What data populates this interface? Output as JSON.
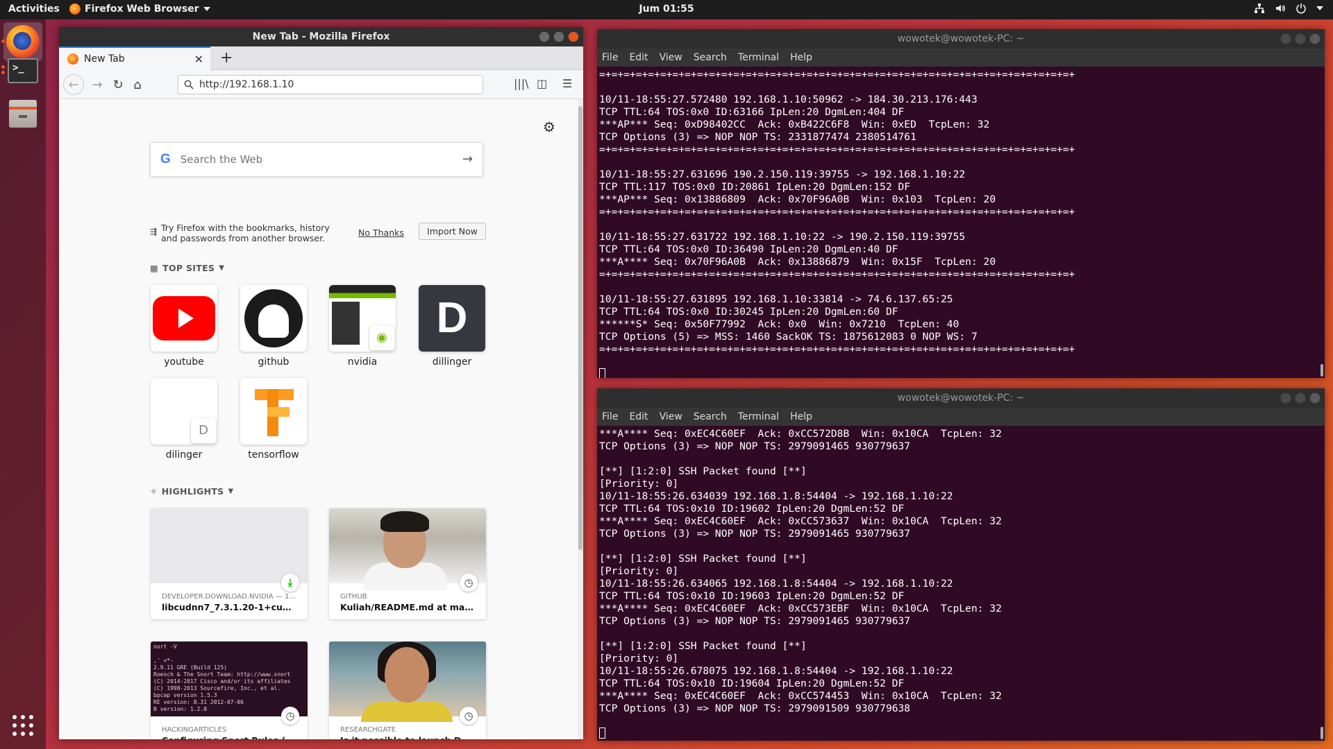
{
  "topbar": {
    "activities": "Activities",
    "app_name": "Firefox Web Browser",
    "clock": "Jum 01:55"
  },
  "firefox": {
    "window_title": "New Tab - Mozilla Firefox",
    "tab_title": "New Tab",
    "url": "http://192.168.1.10",
    "search_placeholder": "Search the Web",
    "google_letter": "G",
    "import_text": "Try Firefox with the bookmarks, history and passwords from another browser.",
    "no_thanks": "No Thanks",
    "import_now": "Import Now",
    "top_sites_title": "TOP SITES",
    "top_sites": [
      {
        "label": "youtube"
      },
      {
        "label": "github"
      },
      {
        "label": "nvidia"
      },
      {
        "label": "dillinger",
        "letter": "D"
      },
      {
        "label": "dilinger",
        "letter": "D"
      },
      {
        "label": "tensorflow"
      }
    ],
    "highlights_title": "HIGHLIGHTS",
    "highlights": [
      {
        "source": "DEVELOPER.DOWNLOAD.NVIDIA — 12...",
        "title": "libcudnn7_7.3.1.20-1+cuda9.0_a..."
      },
      {
        "source": "GITHUB",
        "title": "Kuliah/README.md at master · ..."
      },
      {
        "source": "HACKINGARTICLES",
        "title": "Configuring Snort Rules (Basic...",
        "screenshot_text": "nort -V\n\n,' <*-\n2.9.11 GRE (Build 125)\nRoesch & The Snort Team: http://www.snort\n(C) 2014-2017 Cisco and/or its affiliates\n(C) 1998-2013 Sourcefire, Inc., et al.\nbpcap version 1.5.3\nRE version: 8.31 2012-07-06\nB version: 1.2.8"
      },
      {
        "source": "RESEARCHGATE",
        "title": "Is it possible to launch DDoS at..."
      }
    ]
  },
  "terminal_top": {
    "title": "wowotek@wowotek-PC: ~",
    "menu": [
      "File",
      "Edit",
      "View",
      "Search",
      "Terminal",
      "Help"
    ],
    "lines": [
      "=+=+=+=+=+=+=+=+=+=+=+=+=+=+=+=+=+=+=+=+=+=+=+=+=+=+=+=+=+=+=+=+=+=+=+=+=+=+=+",
      "",
      "10/11-18:55:27.572480 192.168.1.10:50962 -> 184.30.213.176:443",
      "TCP TTL:64 TOS:0x0 ID:63166 IpLen:20 DgmLen:404 DF",
      "***AP*** Seq: 0xD98402CC  Ack: 0xB422C6F8  Win: 0xED  TcpLen: 32",
      "TCP Options (3) => NOP NOP TS: 2331877474 2380514761",
      "=+=+=+=+=+=+=+=+=+=+=+=+=+=+=+=+=+=+=+=+=+=+=+=+=+=+=+=+=+=+=+=+=+=+=+=+=+=+=+",
      "",
      "10/11-18:55:27.631696 190.2.150.119:39755 -> 192.168.1.10:22",
      "TCP TTL:117 TOS:0x0 ID:20861 IpLen:20 DgmLen:152 DF",
      "***AP*** Seq: 0x13886809  Ack: 0x70F96A0B  Win: 0x103  TcpLen: 20",
      "=+=+=+=+=+=+=+=+=+=+=+=+=+=+=+=+=+=+=+=+=+=+=+=+=+=+=+=+=+=+=+=+=+=+=+=+=+=+=+",
      "",
      "10/11-18:55:27.631722 192.168.1.10:22 -> 190.2.150.119:39755",
      "TCP TTL:64 TOS:0x0 ID:36490 IpLen:20 DgmLen:40 DF",
      "***A**** Seq: 0x70F96A0B  Ack: 0x13886879  Win: 0x15F  TcpLen: 20",
      "=+=+=+=+=+=+=+=+=+=+=+=+=+=+=+=+=+=+=+=+=+=+=+=+=+=+=+=+=+=+=+=+=+=+=+=+=+=+=+",
      "",
      "10/11-18:55:27.631895 192.168.1.10:33814 -> 74.6.137.65:25",
      "TCP TTL:64 TOS:0x0 ID:30245 IpLen:20 DgmLen:60 DF",
      "******S* Seq: 0x50F77992  Ack: 0x0  Win: 0x7210  TcpLen: 40",
      "TCP Options (5) => MSS: 1460 SackOK TS: 1875612083 0 NOP WS: 7",
      "=+=+=+=+=+=+=+=+=+=+=+=+=+=+=+=+=+=+=+=+=+=+=+=+=+=+=+=+=+=+=+=+=+=+=+=+=+=+=+"
    ]
  },
  "terminal_bottom": {
    "title": "wowotek@wowotek-PC: ~",
    "menu": [
      "File",
      "Edit",
      "View",
      "Search",
      "Terminal",
      "Help"
    ],
    "lines": [
      "***A**** Seq: 0xEC4C60EF  Ack: 0xCC572D8B  Win: 0x10CA  TcpLen: 32",
      "TCP Options (3) => NOP NOP TS: 2979091465 930779637",
      "",
      "[**] [1:2:0] SSH Packet found [**]",
      "[Priority: 0]",
      "10/11-18:55:26.634039 192.168.1.8:54404 -> 192.168.1.10:22",
      "TCP TTL:64 TOS:0x10 ID:19602 IpLen:20 DgmLen:52 DF",
      "***A**** Seq: 0xEC4C60EF  Ack: 0xCC573637  Win: 0x10CA  TcpLen: 32",
      "TCP Options (3) => NOP NOP TS: 2979091465 930779637",
      "",
      "[**] [1:2:0] SSH Packet found [**]",
      "[Priority: 0]",
      "10/11-18:55:26.634065 192.168.1.8:54404 -> 192.168.1.10:22",
      "TCP TTL:64 TOS:0x10 ID:19603 IpLen:20 DgmLen:52 DF",
      "***A**** Seq: 0xEC4C60EF  Ack: 0xCC573EBF  Win: 0x10CA  TcpLen: 32",
      "TCP Options (3) => NOP NOP TS: 2979091465 930779637",
      "",
      "[**] [1:2:0] SSH Packet found [**]",
      "[Priority: 0]",
      "10/11-18:55:26.678075 192.168.1.8:54404 -> 192.168.1.10:22",
      "TCP TTL:64 TOS:0x10 ID:19604 IpLen:20 DgmLen:52 DF",
      "***A**** Seq: 0xEC4C60EF  Ack: 0xCC574453  Win: 0x10CA  TcpLen: 32",
      "TCP Options (3) => NOP NOP TS: 2979091509 930779638"
    ]
  },
  "colors": {
    "terminal_bg": "#300a24",
    "ubuntu_orange": "#e95420",
    "firefox_accent": "#0a84ff"
  }
}
